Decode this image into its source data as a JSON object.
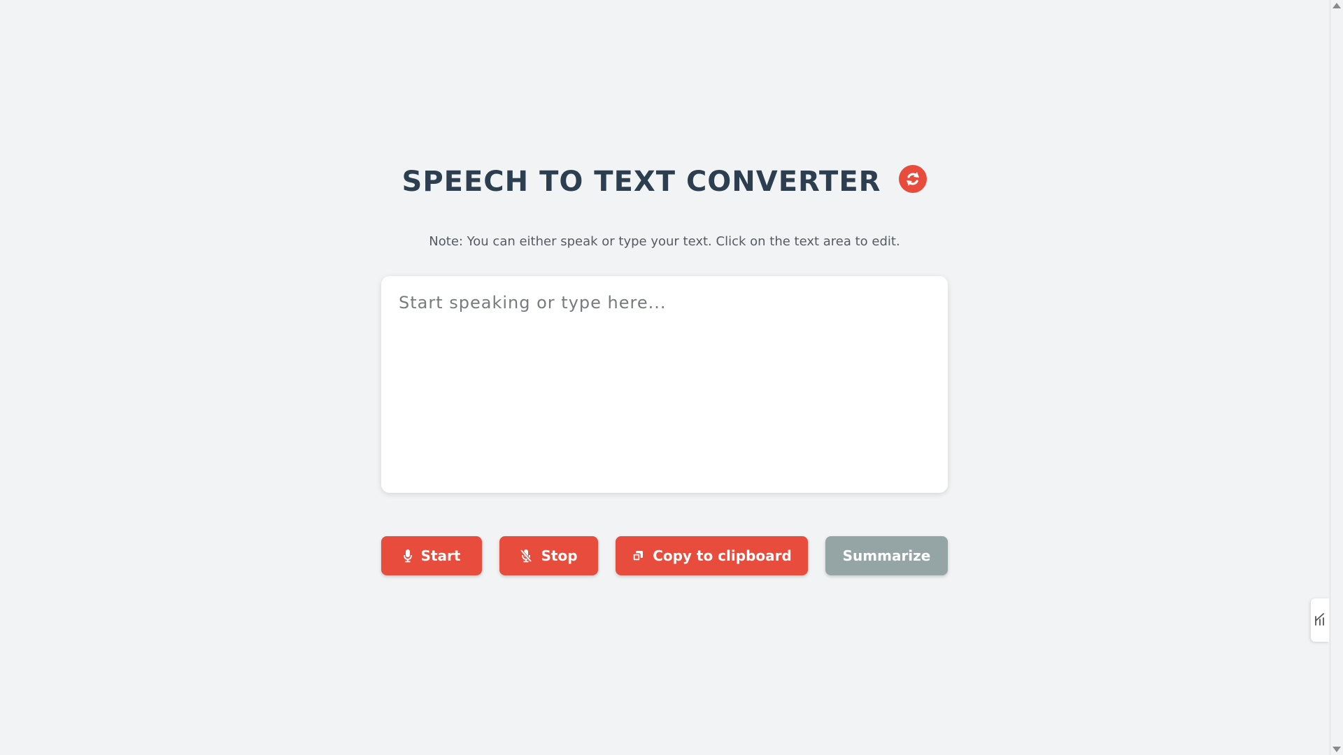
{
  "app": {
    "title": "SPEECH TO TEXT CONVERTER",
    "note": "Note: You can either speak or type your text. Click on the text area to edit."
  },
  "editor": {
    "placeholder": "Start speaking or type here...",
    "value": ""
  },
  "buttons": {
    "start_label": "Start",
    "stop_label": "Stop",
    "copy_label": "Copy to clipboard",
    "summarize_label": "Summarize"
  },
  "icons": {
    "title_badge": "refresh-icon",
    "start": "microphone-icon",
    "stop": "microphone-off-icon",
    "copy": "clipboard-icon",
    "side_tab": "extension-icon"
  },
  "colors": {
    "accent": "#e74c3c",
    "heading": "#2c3e50",
    "disabled_button": "#95a5a6",
    "background": "#f2f3f4"
  }
}
